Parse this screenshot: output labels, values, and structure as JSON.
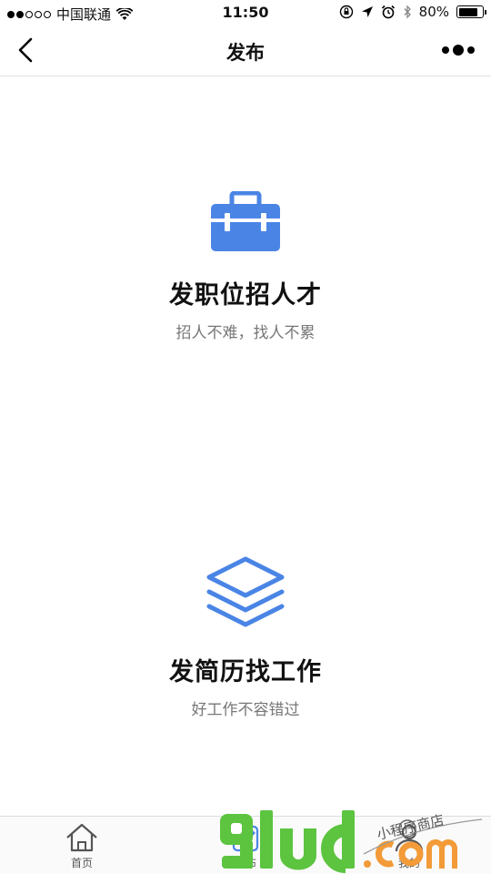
{
  "status_bar": {
    "carrier": "中国联通",
    "time": "11:50",
    "battery": "80%",
    "battery_level": 0.8
  },
  "nav": {
    "title": "发布"
  },
  "options": [
    {
      "title": "发职位招人才",
      "subtitle": "招人不难，找人不累",
      "icon": "briefcase-icon"
    },
    {
      "title": "发简历找工作",
      "subtitle": "好工作不容错过",
      "icon": "layers-icon"
    }
  ],
  "tabs": [
    {
      "label": "首页",
      "icon": "home-icon"
    },
    {
      "label": "发布",
      "icon": "edit-icon"
    },
    {
      "label": "我的",
      "icon": "user-icon"
    }
  ],
  "watermark": {
    "logo": "9lud.com",
    "caption": "小程序商店"
  },
  "colors": {
    "accent": "#4a85e6",
    "watermark_green": "#5cc43f",
    "watermark_orange": "#f29b38"
  }
}
